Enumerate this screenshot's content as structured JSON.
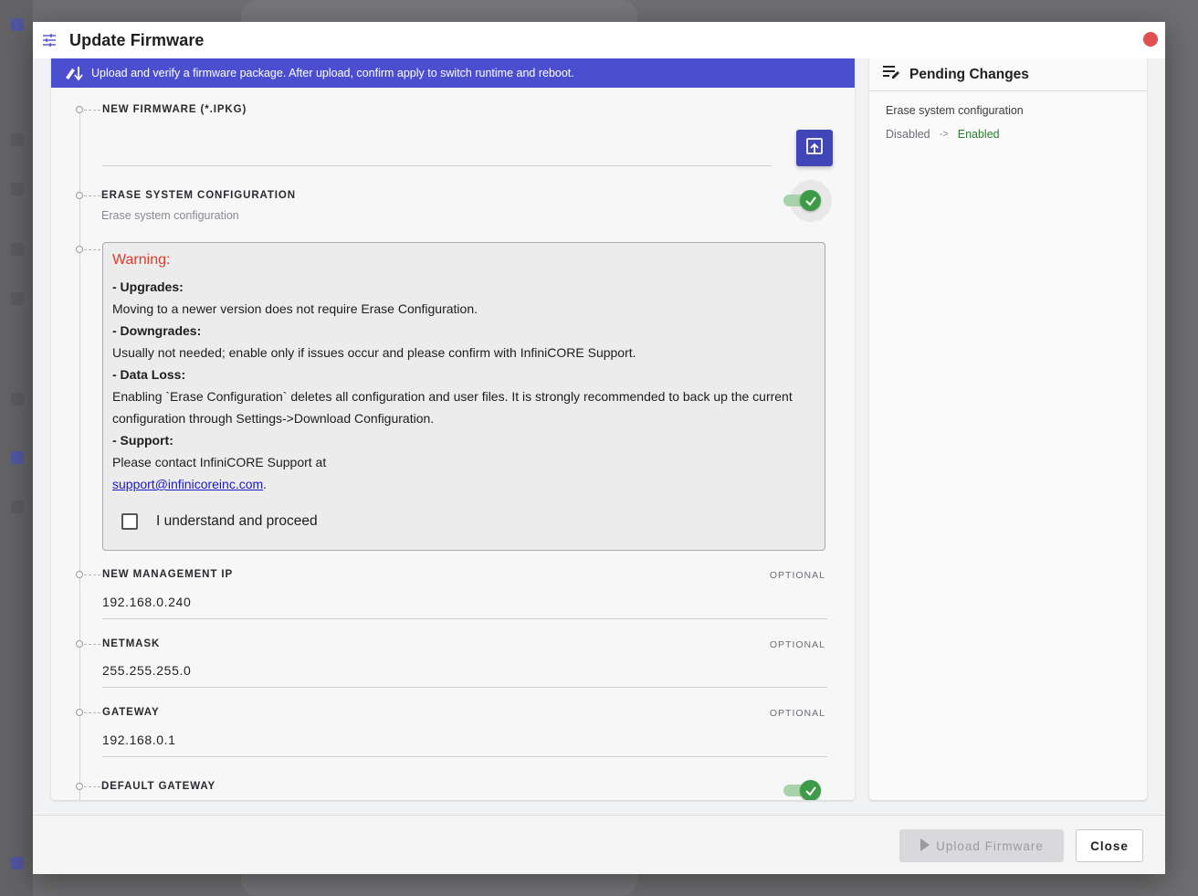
{
  "dialog": {
    "title": "Update Firmware",
    "title_icon": "sliders-icon",
    "close_color": "#e05050"
  },
  "banner": {
    "icon": "firmware-download-icon",
    "text": "Upload and verify a firmware package. After upload, confirm apply to switch runtime and reboot.",
    "color": "#4b4fcf"
  },
  "form": {
    "firmware": {
      "label": "NEW FIRMWARE (*.IPKG)",
      "value": "",
      "upload_icon": "upload-file-icon"
    },
    "erase": {
      "label": "ERASE SYSTEM CONFIGURATION",
      "sublabel": "Erase system configuration",
      "enabled": true
    },
    "warning": {
      "title": "Warning:",
      "upgrades_head": "- Upgrades:",
      "upgrades_text": "Moving to a newer version does not require Erase Configuration.",
      "downgrades_head": "- Downgrades:",
      "downgrades_text": "Usually not needed; enable only if issues occur and please confirm with InfiniCORE Support.",
      "dataloss_head": "- Data Loss:",
      "dataloss_text_1": "Enabling `Erase Configuration` deletes all configuration and user files. It is strongly recommended to back up the current",
      "dataloss_text_2": "configuration through Settings->Download Configuration.",
      "support_head": "- Support:",
      "support_text": "Please contact InfiniCORE Support at",
      "support_email": "support@infinicoreinc.com",
      "support_period": ".",
      "ack_label": "I understand and proceed",
      "ack_checked": false
    },
    "mgmt_ip": {
      "label": "NEW MANAGEMENT IP",
      "optional": "OPTIONAL",
      "value": "192.168.0.240"
    },
    "netmask": {
      "label": "NETMASK",
      "optional": "OPTIONAL",
      "value": "255.255.255.0"
    },
    "gateway": {
      "label": "GATEWAY",
      "optional": "OPTIONAL",
      "value": "192.168.0.1"
    },
    "default_gateway": {
      "label": "DEFAULT GATEWAY",
      "enabled": true
    }
  },
  "pending": {
    "title": "Pending Changes",
    "icon": "list-edit-icon",
    "changes": [
      {
        "name": "Erase system configuration",
        "from": "Disabled",
        "arrow": "->",
        "to": "Enabled"
      }
    ]
  },
  "footer": {
    "upload_label": "Upload Firmware",
    "close_label": "Close"
  }
}
